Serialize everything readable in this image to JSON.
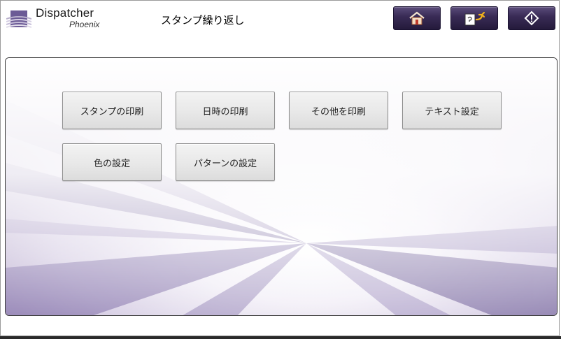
{
  "app": {
    "name": "Dispatcher",
    "subname": "Phoenix"
  },
  "header": {
    "title": "スタンプ繰り返し",
    "buttons": [
      {
        "name": "home-button",
        "icon": "home-icon"
      },
      {
        "name": "back-button",
        "icon": "return-document-icon"
      },
      {
        "name": "start-button",
        "icon": "start-diamond-icon"
      }
    ]
  },
  "menu": {
    "items": [
      {
        "label": "スタンプの印刷"
      },
      {
        "label": "日時の印刷"
      },
      {
        "label": "その他を印刷"
      },
      {
        "label": "テキスト設定"
      },
      {
        "label": "色の設定"
      },
      {
        "label": "パターンの設定"
      }
    ]
  },
  "colors": {
    "header_button": "#3a2c57",
    "accent_purple": "#6b5a95",
    "tile_bg": "#e8e8e8"
  }
}
